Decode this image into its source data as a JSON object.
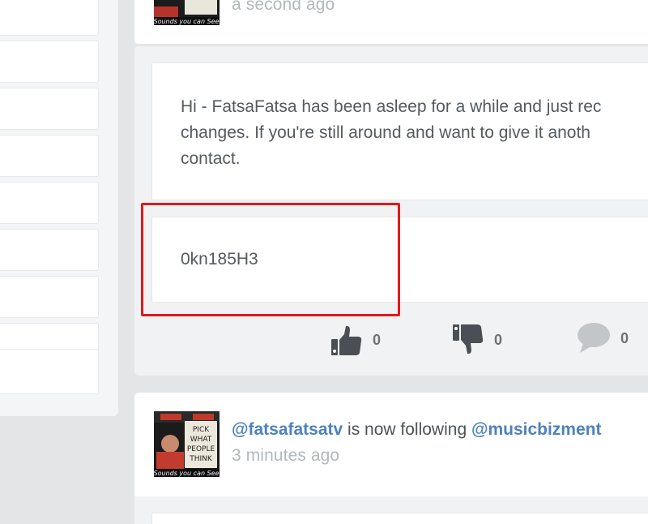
{
  "top_post": {
    "timestamp": "a second ago"
  },
  "main_post": {
    "message": "Hi - FatsaFatsa has been asleep for a while and just rec\nchanges. If you're still around and want to give it anoth\ncontact.",
    "code": "0kn185H3",
    "actions": {
      "like_count": "0",
      "dislike_count": "0",
      "comment_count": "0"
    }
  },
  "follow_post": {
    "actor": "@fatsafatsatv",
    "verb": "is now following",
    "target": "@musicbizment",
    "timestamp": "3 minutes ago"
  },
  "avatar": {
    "sign_lines": [
      "PICK",
      "WHAT",
      "PEOPLE",
      "THINK"
    ],
    "caption": "Sounds you can See"
  },
  "colors": {
    "link": "#4d82bd",
    "highlight": "#e1191c",
    "icon": "#4a4f55"
  }
}
